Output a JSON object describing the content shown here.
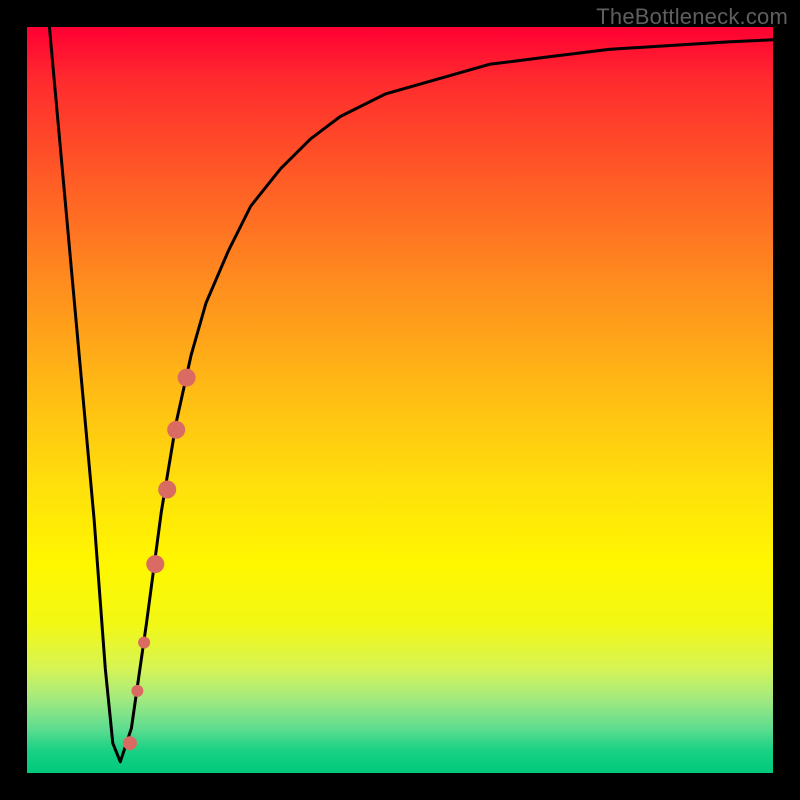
{
  "watermark": "TheBottleneck.com",
  "chart_data": {
    "type": "line",
    "title": "",
    "xlabel": "",
    "ylabel": "",
    "xlim": [
      0,
      100
    ],
    "ylim": [
      0,
      100
    ],
    "curve": {
      "name": "bottleneck-curve",
      "x": [
        3,
        5,
        7,
        9,
        10.5,
        11.5,
        12.5,
        14,
        16,
        18,
        20,
        22,
        24,
        27,
        30,
        34,
        38,
        42,
        48,
        55,
        62,
        70,
        78,
        86,
        94,
        100
      ],
      "y": [
        100,
        78,
        56,
        34,
        14,
        4,
        1.5,
        6,
        20,
        35,
        47,
        56,
        63,
        70,
        76,
        81,
        85,
        88,
        91,
        93,
        95,
        96,
        97,
        97.5,
        98,
        98.3
      ]
    },
    "marker_series": {
      "name": "highlighted-points",
      "color": "#d96b63",
      "points": [
        {
          "x": 13.8,
          "y": 4.0,
          "r": 7
        },
        {
          "x": 14.8,
          "y": 11.0,
          "r": 6
        },
        {
          "x": 15.7,
          "y": 17.5,
          "r": 6
        },
        {
          "x": 17.2,
          "y": 28.0,
          "r": 9
        },
        {
          "x": 18.8,
          "y": 38.0,
          "r": 9
        },
        {
          "x": 20.0,
          "y": 46.0,
          "r": 9
        },
        {
          "x": 21.4,
          "y": 53.0,
          "r": 9
        }
      ]
    }
  }
}
